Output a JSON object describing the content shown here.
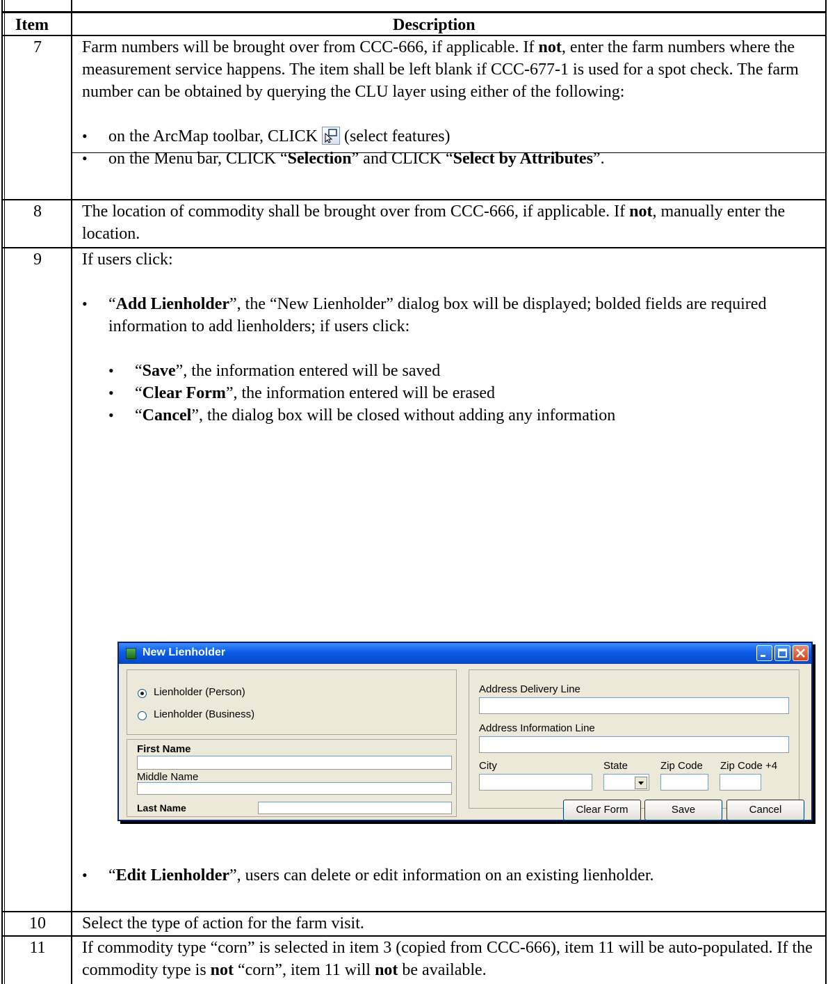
{
  "header": {
    "item": "Item",
    "description": "Description"
  },
  "rows": [
    {
      "item": "7",
      "p1": "Farm numbers will be brought over from CCC-666, if applicable.  If ",
      "p1_bold": "not",
      "p1_rest": ", enter the farm numbers where the measurement service happens.  The item shall be left blank if CCC-677-1 is used for a spot check.  The farm number can be obtained by querying the CLU layer using either of the following:",
      "b1_pre": "on the ArcMap toolbar, CLICK ",
      "b1_post": " (select features)",
      "b2_pre": "on the Menu bar, CLICK “",
      "b2_bold1": "Selection",
      "b2_mid": "” and CLICK “",
      "b2_bold2": "Select by Attributes",
      "b2_end": "”."
    },
    {
      "item": "8",
      "p1": "The location of commodity shall be brought over from CCC-666, if applicable.  If ",
      "p1_bold": "not",
      "p1_rest": ", manually enter the location."
    },
    {
      "item": "9",
      "intro": "If users click:",
      "add_q1": "“",
      "add_bold": "Add Lienholder",
      "add_rest": "”, the “New Lienholder” dialog box will be displayed; bolded fields are required information to add lienholders; if users click:",
      "sub": [
        {
          "q": "“",
          "bold": "Save",
          "rest": "”, the information entered will be saved"
        },
        {
          "q": "“",
          "bold": "Clear Form",
          "rest": "”, the information entered will be erased"
        },
        {
          "q": "“",
          "bold": "Cancel",
          "rest": "”, the dialog box will be closed without adding any information"
        }
      ],
      "edit_q1": "“",
      "edit_bold": "Edit Lienholder",
      "edit_rest": "”, users can delete or edit information on an existing lienholder."
    },
    {
      "item": "10",
      "text": "Select the type of action for the farm visit."
    },
    {
      "item": "11",
      "t1": "If commodity type “corn” is selected in item 3 (copied from CCC-666), item 11 will be auto-populated.  If the commodity type is ",
      "b1": "not",
      "t2": " “corn”, item 11 will ",
      "b2": "not",
      "t3": " be available."
    }
  ],
  "dialog": {
    "title": "New Lienholder",
    "radio_person": "Lienholder (Person)",
    "radio_business": "Lienholder (Business)",
    "first_name": "First Name",
    "middle_name": "Middle Name",
    "last_name": "Last Name",
    "address_delivery": "Address Delivery Line",
    "address_info": "Address Information Line",
    "city": "City",
    "state": "State",
    "zip": "Zip Code",
    "zip4": "Zip Code +4",
    "btn_clear": "Clear Form",
    "btn_save": "Save",
    "btn_cancel": "Cancel"
  }
}
